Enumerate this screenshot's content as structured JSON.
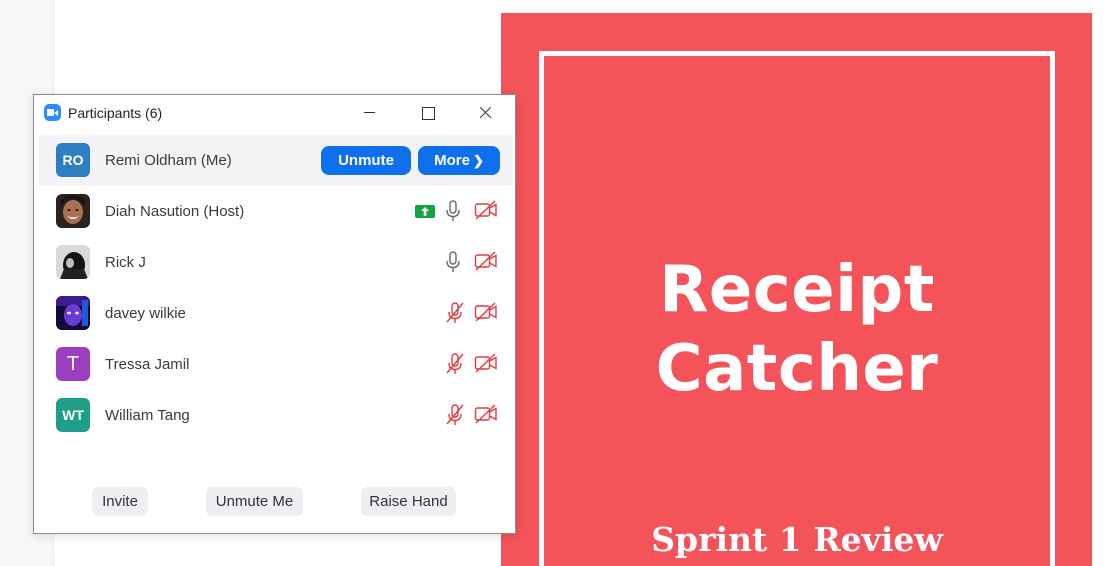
{
  "window": {
    "title": "Participants (6)"
  },
  "participants": [
    {
      "initials": "RO",
      "name": "Remi Oldham (Me)",
      "color": "#2d7fc1",
      "is_me": true
    },
    {
      "initials": "",
      "name": "Diah Nasution (Host)",
      "avatar": "photo",
      "sharing": true,
      "mic": "on",
      "video": "off"
    },
    {
      "initials": "",
      "name": "Rick J",
      "avatar": "photo",
      "mic": "on",
      "video": "off"
    },
    {
      "initials": "",
      "name": "davey wilkie",
      "avatar": "photo",
      "mic": "muted",
      "video": "off"
    },
    {
      "initials": "T",
      "name": "Tressa Jamil",
      "color": "#9b3fbf",
      "mic": "muted",
      "video": "off"
    },
    {
      "initials": "WT",
      "name": "William Tang",
      "color": "#1f9e8a",
      "mic": "muted",
      "video": "off"
    }
  ],
  "me_actions": {
    "unmute": "Unmute",
    "more": "More",
    "more_chevron": "❯"
  },
  "footer": {
    "invite": "Invite",
    "unmute_me": "Unmute Me",
    "raise_hand": "Raise Hand"
  },
  "slide": {
    "title_line1": "Receipt",
    "title_line2": "Catcher",
    "subtitle": "Sprint 1 Review",
    "bg_color": "#f4535a"
  },
  "colors": {
    "accent_blue": "#0e71eb",
    "muted_red": "#e0393e",
    "share_green": "#12a442"
  }
}
